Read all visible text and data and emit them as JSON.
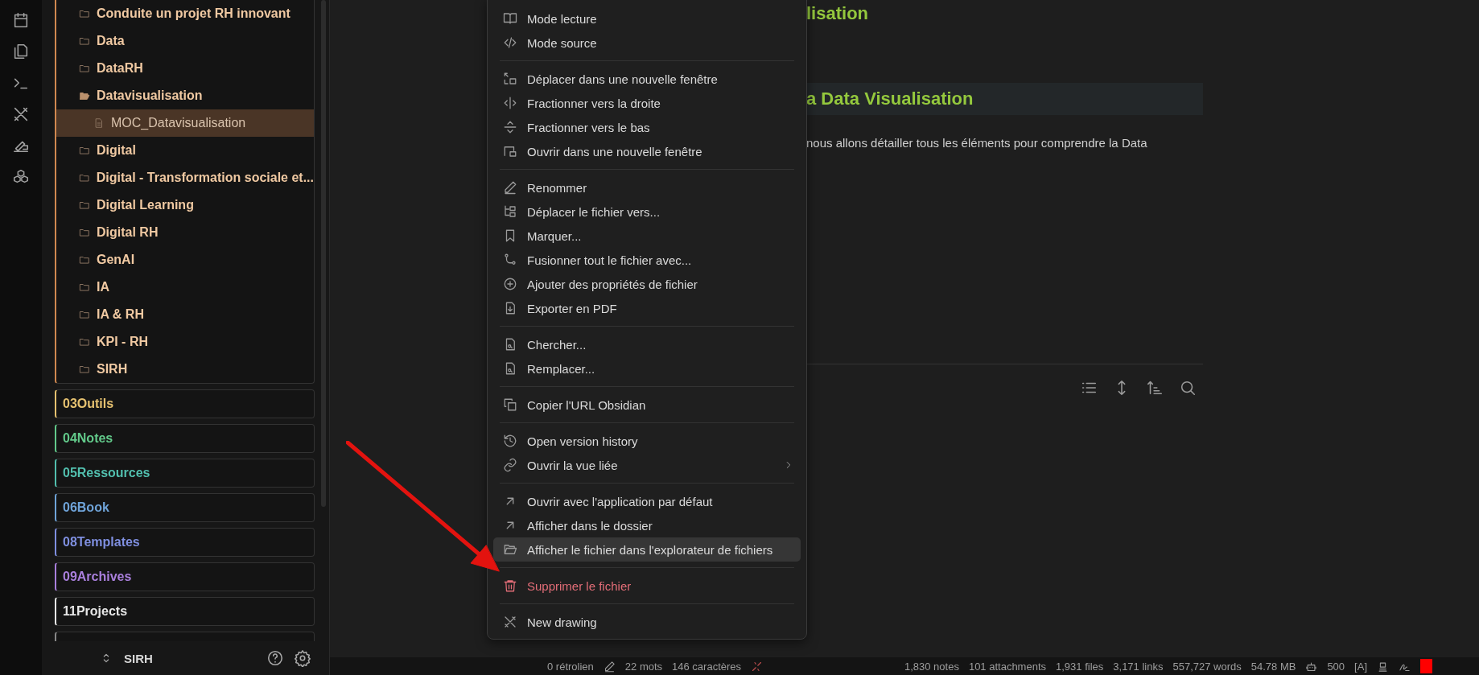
{
  "sidebar": {
    "tree": [
      {
        "label": "Conduite un projet RH innovant",
        "expanded": false,
        "selected": false
      },
      {
        "label": "Data",
        "expanded": false,
        "selected": false
      },
      {
        "label": "DataRH",
        "expanded": false,
        "selected": false
      },
      {
        "label": "Datavisualisation",
        "expanded": true,
        "selected": false,
        "children": [
          {
            "label": "MOC_Datavisualisation",
            "selected": true
          }
        ]
      },
      {
        "label": "Digital",
        "expanded": false,
        "selected": false
      },
      {
        "label": "Digital - Transformation sociale et...",
        "expanded": false,
        "selected": false
      },
      {
        "label": "Digital Learning",
        "expanded": false,
        "selected": false
      },
      {
        "label": "Digital RH",
        "expanded": false,
        "selected": false
      },
      {
        "label": "GenAI",
        "expanded": false,
        "selected": false
      },
      {
        "label": "IA",
        "expanded": false,
        "selected": false
      },
      {
        "label": "IA & RH",
        "expanded": false,
        "selected": false
      },
      {
        "label": "KPI - RH",
        "expanded": false,
        "selected": false
      },
      {
        "label": "SIRH",
        "expanded": false,
        "selected": false
      }
    ],
    "folders": [
      {
        "label": "03Outils",
        "color": "#e5c170"
      },
      {
        "label": "04Notes",
        "color": "#62c98a"
      },
      {
        "label": "05Ressources",
        "color": "#52bfae"
      },
      {
        "label": "06Book",
        "color": "#6fa3d8"
      },
      {
        "label": "08Templates",
        "color": "#7f8fe0"
      },
      {
        "label": "09Archives",
        "color": "#a97fdc"
      },
      {
        "label": "11Projects",
        "color": "#e6e6e6"
      }
    ],
    "vault": "SIRH"
  },
  "note": {
    "title": "lisation",
    "heading": "a Data Visualisation",
    "paragraph": "nous allons détailler tous les éléments pour comprendre la Data"
  },
  "menu": {
    "groups": [
      [
        {
          "label": "Mode lecture",
          "kind": "action",
          "selected": false
        },
        {
          "label": "Mode source",
          "kind": "action",
          "selected": false
        }
      ],
      [
        {
          "label": "Déplacer dans une nouvelle fenêtre",
          "kind": "action",
          "selected": false
        },
        {
          "label": "Fractionner vers la droite",
          "kind": "action",
          "selected": false
        },
        {
          "label": "Fractionner vers le bas",
          "kind": "action",
          "selected": false
        },
        {
          "label": "Ouvrir dans une nouvelle fenêtre",
          "kind": "action",
          "selected": false
        }
      ],
      [
        {
          "label": "Renommer",
          "kind": "action",
          "selected": false
        },
        {
          "label": "Déplacer le fichier vers...",
          "kind": "action",
          "selected": false
        },
        {
          "label": "Marquer...",
          "kind": "action",
          "selected": false
        },
        {
          "label": "Fusionner tout le fichier avec...",
          "kind": "action",
          "selected": false
        },
        {
          "label": "Ajouter des propriétés de fichier",
          "kind": "action",
          "selected": false
        },
        {
          "label": "Exporter en PDF",
          "kind": "action",
          "selected": false
        }
      ],
      [
        {
          "label": "Chercher...",
          "kind": "action",
          "selected": false
        },
        {
          "label": "Remplacer...",
          "kind": "action",
          "selected": false
        }
      ],
      [
        {
          "label": "Copier l'URL Obsidian",
          "kind": "action",
          "selected": false
        }
      ],
      [
        {
          "label": "Open version history",
          "kind": "action",
          "selected": false
        },
        {
          "label": "Ouvrir la vue liée",
          "kind": "submenu",
          "selected": false
        }
      ],
      [
        {
          "label": "Ouvrir avec l'application par défaut",
          "kind": "action",
          "selected": false
        },
        {
          "label": "Afficher dans le dossier",
          "kind": "action",
          "selected": false
        },
        {
          "label": "Afficher le fichier dans l'explorateur de fichiers",
          "kind": "action",
          "selected": true
        }
      ],
      [
        {
          "label": "Supprimer le fichier",
          "kind": "danger",
          "selected": false
        }
      ],
      [
        {
          "label": "New drawing",
          "kind": "action",
          "selected": false
        }
      ]
    ]
  },
  "status_bar": {
    "left": [
      "0 rétrolien",
      "22 mots",
      "146 caractères"
    ],
    "right": [
      "1,830 notes",
      "101 attachments",
      "1,931 files",
      "3,171 links",
      "557,727 words",
      "54.78 MB"
    ],
    "count": "500",
    "mode": "[A]"
  }
}
